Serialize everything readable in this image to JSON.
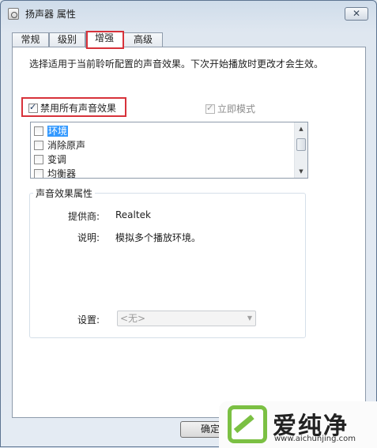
{
  "window": {
    "title": "扬声器 属性",
    "close_glyph": "✕"
  },
  "tabs": [
    {
      "label": "常规"
    },
    {
      "label": "级别"
    },
    {
      "label": "增强",
      "active": true
    },
    {
      "label": "高级"
    }
  ],
  "enhance": {
    "description": "选择适用于当前聆听配置的声音效果。下次开始播放时更改才会生效。",
    "disable_all": {
      "label": "禁用所有声音效果",
      "checked": true
    },
    "immediate_mode": {
      "label": "立即模式",
      "checked": true,
      "disabled": true
    },
    "effects": [
      {
        "label": "环境",
        "checked": false,
        "selected": true
      },
      {
        "label": "消除原声",
        "checked": false
      },
      {
        "label": "变调",
        "checked": false
      },
      {
        "label": "均衡器",
        "checked": false
      }
    ]
  },
  "properties": {
    "group_title": "声音效果属性",
    "provider_label": "提供商:",
    "provider_value": "Realtek",
    "description_label": "说明:",
    "description_value": "模拟多个播放环境。",
    "setting_label": "设置:",
    "setting_value": "<无>"
  },
  "buttons": {
    "ok": "确定"
  },
  "watermark": {
    "brand": "爱纯净",
    "url": "www.aichunjing.com"
  },
  "colors": {
    "highlight_box": "#d7323a",
    "selection": "#3399ff",
    "watermark_green": "#7bc043"
  }
}
